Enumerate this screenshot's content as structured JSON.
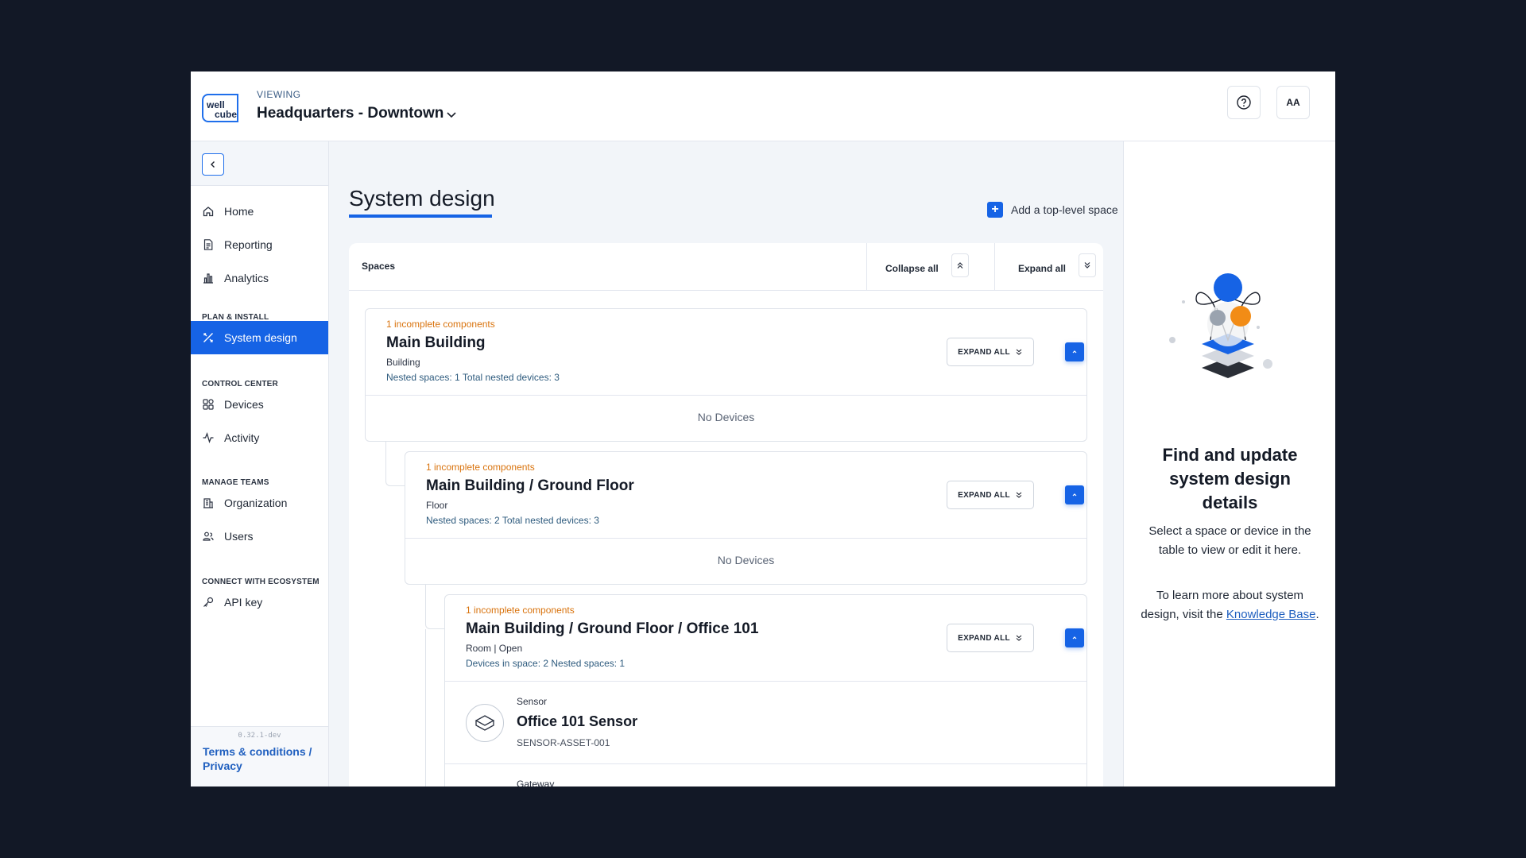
{
  "header": {
    "logo_line1": "well",
    "logo_line2": "cube",
    "viewing_label": "VIEWING",
    "site_name": "Headquarters - Downtown",
    "avatar_initials": "AA"
  },
  "sidebar": {
    "items_top": [
      {
        "label": "Home",
        "icon": "home-icon"
      },
      {
        "label": "Reporting",
        "icon": "report-icon"
      },
      {
        "label": "Analytics",
        "icon": "bar-chart-icon"
      }
    ],
    "section_plan": "PLAN & INSTALL",
    "system_design": "System design",
    "section_control": "CONTROL CENTER",
    "devices": "Devices",
    "activity": "Activity",
    "section_teams": "MANAGE TEAMS",
    "organization": "Organization",
    "users": "Users",
    "section_ecosystem": "CONNECT WITH ECOSYSTEM",
    "api_key": "API key",
    "version": "0.32.1-dev",
    "terms": "Terms & conditions / Privacy"
  },
  "main": {
    "title": "System design",
    "add_space": "Add a top-level space",
    "table": {
      "col_spaces": "Spaces",
      "collapse_all": "Collapse all",
      "expand_all": "Expand all"
    },
    "spaces": [
      {
        "incomplete": "1 incomplete components",
        "name": "Main Building",
        "type": "Building",
        "counts": "Nested spaces: 1 Total nested devices: 3",
        "expand_label": "EXPAND ALL",
        "empty": "No Devices"
      },
      {
        "incomplete": "1 incomplete components",
        "name": "Main Building / Ground Floor",
        "type": "Floor",
        "counts": "Nested spaces: 2 Total nested devices: 3",
        "expand_label": "EXPAND ALL",
        "empty": "No Devices"
      },
      {
        "incomplete": "1 incomplete components",
        "name": "Main Building / Ground Floor / Office 101",
        "type": "Room | Open",
        "counts": "Devices in space: 2 Nested spaces: 1",
        "expand_label": "EXPAND ALL"
      }
    ],
    "devices": [
      {
        "kind": "Sensor",
        "name": "Office 101 Sensor",
        "asset": "SENSOR-ASSET-001"
      },
      {
        "kind": "Gateway"
      }
    ]
  },
  "panel": {
    "title": "Find and update system design details",
    "text1": "Select a space or device in the table to view or edit it here.",
    "text2_prefix": "To learn more about system design, visit the",
    "link": "Knowledge Base",
    "text2_suffix": "."
  },
  "colors": {
    "accent": "#1663e5",
    "warning": "#d9730d",
    "backdrop": "#121826"
  }
}
